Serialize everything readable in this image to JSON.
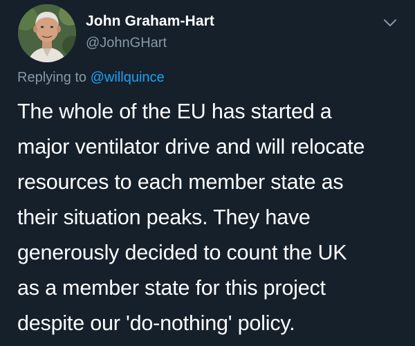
{
  "author": {
    "display_name": "John Graham-Hart",
    "handle": "@JohnGHart"
  },
  "reply": {
    "prefix": "Replying to",
    "mention": "@willquince"
  },
  "tweet": {
    "lines": [
      "The whole of the EU has started a",
      "major ventilator drive and will relocate",
      "resources to each member state as",
      "their situation peaks. They have",
      "generously decided to count the UK",
      "as a member state for this project",
      "despite our 'do-nothing' policy."
    ]
  },
  "icons": {
    "menu": "chevron-down-icon"
  },
  "colors": {
    "background": "#15202b",
    "secondary_text": "#8899a6",
    "link": "#1da1f2"
  }
}
